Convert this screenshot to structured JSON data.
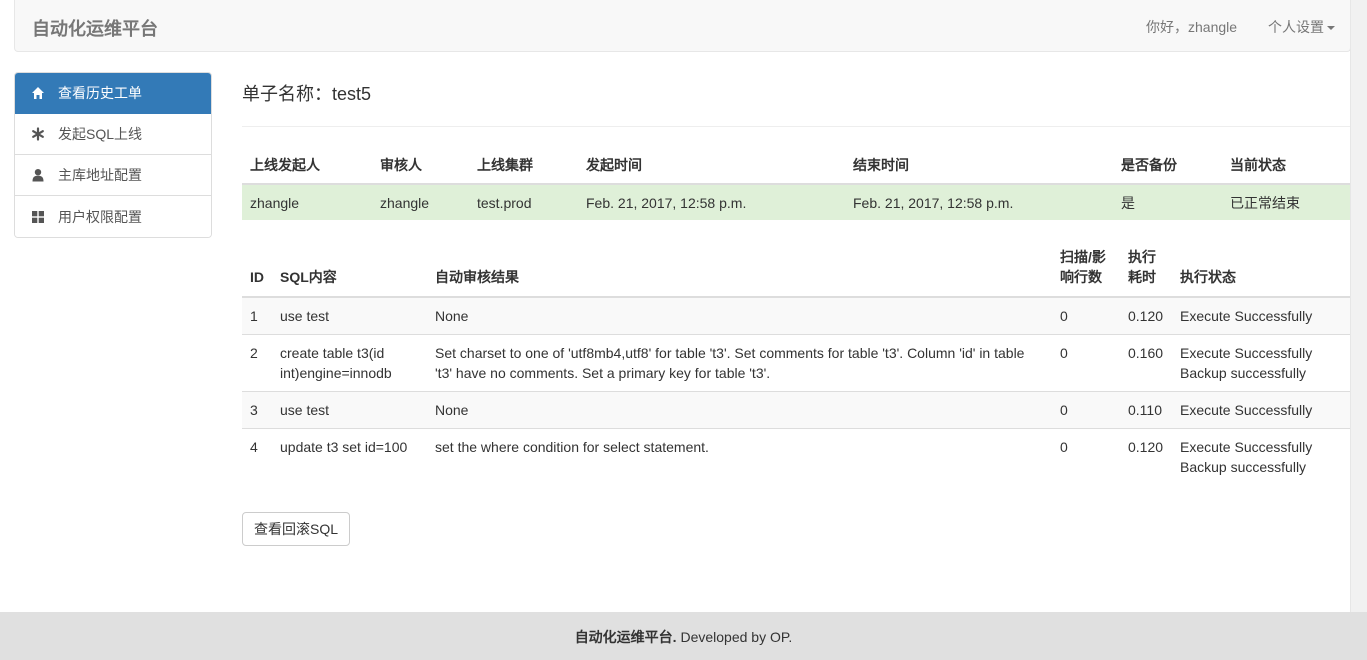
{
  "navbar": {
    "brand": "自动化运维平台",
    "greeting": "你好，zhangle",
    "settings_label": "个人设置"
  },
  "sidebar": {
    "items": [
      {
        "label": "查看历史工单",
        "icon": "home-icon",
        "active": true
      },
      {
        "label": "发起SQL上线",
        "icon": "asterisk-icon",
        "active": false
      },
      {
        "label": "主库地址配置",
        "icon": "user-icon",
        "active": false
      },
      {
        "label": "用户权限配置",
        "icon": "th-large-icon",
        "active": false
      }
    ]
  },
  "main": {
    "title_label": "单子名称：",
    "title_value": "test5",
    "summary": {
      "headers": [
        "上线发起人",
        "审核人",
        "上线集群",
        "发起时间",
        "结束时间",
        "是否备份",
        "当前状态"
      ],
      "row": [
        "zhangle",
        "zhangle",
        "test.prod",
        "Feb. 21, 2017, 12:58 p.m.",
        "Feb. 21, 2017, 12:58 p.m.",
        "是",
        "已正常结束"
      ]
    },
    "details": {
      "headers": {
        "id": "ID",
        "sql": "SQL内容",
        "audit": "自动审核结果",
        "rows_1": "扫描/影",
        "rows_2": "响行数",
        "time_1": "执行",
        "time_2": "耗时",
        "status": "执行状态"
      },
      "rows": [
        {
          "id": "1",
          "sql": "use test",
          "audit": "None",
          "affected": "0",
          "time": "0.120",
          "status1": "Execute Successfully",
          "status2": ""
        },
        {
          "id": "2",
          "sql": "create table t3(id int)engine=innodb",
          "audit": "Set charset to one of 'utf8mb4,utf8' for table 't3'. Set comments for table 't3'. Column 'id' in table 't3' have no comments. Set a primary key for table 't3'.",
          "affected": "0",
          "time": "0.160",
          "status1": "Execute Successfully",
          "status2": "Backup successfully"
        },
        {
          "id": "3",
          "sql": "use test",
          "audit": "None",
          "affected": "0",
          "time": "0.110",
          "status1": "Execute Successfully",
          "status2": ""
        },
        {
          "id": "4",
          "sql": "update t3 set id=100",
          "audit": "set the where condition for select statement.",
          "affected": "0",
          "time": "0.120",
          "status1": "Execute Successfully",
          "status2": "Backup successfully"
        }
      ]
    },
    "rollback_button": "查看回滚SQL"
  },
  "footer": {
    "brand": "自动化运维平台.",
    "text": " Developed by OP."
  }
}
